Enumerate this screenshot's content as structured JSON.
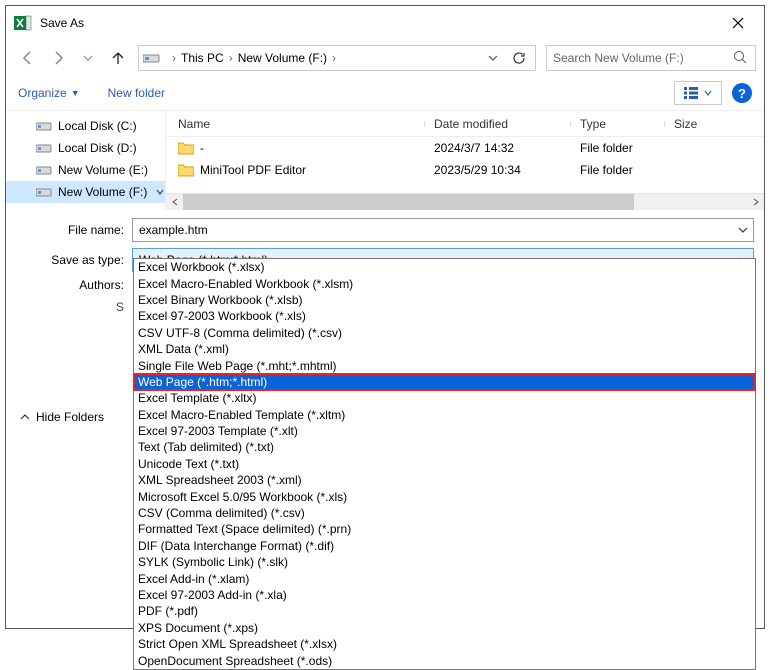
{
  "window": {
    "title": "Save As"
  },
  "nav": {
    "breadcrumb": [
      "This PC",
      "New Volume (F:)"
    ],
    "search_placeholder": "Search New Volume (F:)"
  },
  "toolbar": {
    "organize": "Organize",
    "new_folder": "New folder"
  },
  "tree": {
    "items": [
      {
        "label": "Local Disk (C:)"
      },
      {
        "label": "Local Disk (D:)"
      },
      {
        "label": "New Volume (E:)"
      },
      {
        "label": "New Volume (F:)"
      }
    ],
    "selected_index": 3
  },
  "list": {
    "columns": {
      "name": "Name",
      "date": "Date modified",
      "type": "Type",
      "size": "Size"
    },
    "rows": [
      {
        "name": "-",
        "date": "2024/3/7 14:32",
        "type": "File folder"
      },
      {
        "name": "MiniTool PDF Editor",
        "date": "2023/5/29 10:34",
        "type": "File folder"
      }
    ]
  },
  "form": {
    "filename_label": "File name:",
    "filename_value": "example.htm",
    "savetype_label": "Save as type:",
    "savetype_value": "Web Page (*.htm;*.html)",
    "authors_label": "Authors:",
    "s_label": "S"
  },
  "hide_folders": "Hide Folders",
  "type_options": [
    "Excel Workbook (*.xlsx)",
    "Excel Macro-Enabled Workbook (*.xlsm)",
    "Excel Binary Workbook (*.xlsb)",
    "Excel 97-2003 Workbook (*.xls)",
    "CSV UTF-8 (Comma delimited) (*.csv)",
    "XML Data (*.xml)",
    "Single File Web Page (*.mht;*.mhtml)",
    "Web Page (*.htm;*.html)",
    "Excel Template (*.xltx)",
    "Excel Macro-Enabled Template (*.xltm)",
    "Excel 97-2003 Template (*.xlt)",
    "Text (Tab delimited) (*.txt)",
    "Unicode Text (*.txt)",
    "XML Spreadsheet 2003 (*.xml)",
    "Microsoft Excel 5.0/95 Workbook (*.xls)",
    "CSV (Comma delimited) (*.csv)",
    "Formatted Text (Space delimited) (*.prn)",
    "DIF (Data Interchange Format) (*.dif)",
    "SYLK (Symbolic Link) (*.slk)",
    "Excel Add-in (*.xlam)",
    "Excel 97-2003 Add-in (*.xla)",
    "PDF (*.pdf)",
    "XPS Document (*.xps)",
    "Strict Open XML Spreadsheet (*.xlsx)",
    "OpenDocument Spreadsheet (*.ods)"
  ],
  "type_selected_index": 7
}
